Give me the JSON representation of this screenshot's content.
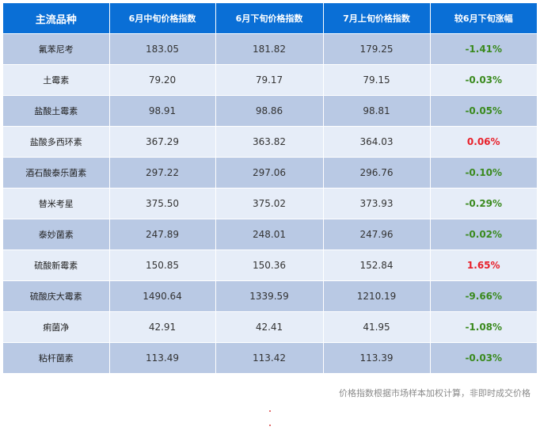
{
  "table": {
    "headers": [
      "主流品种",
      "6月中旬价格指数",
      "6月下旬价格指数",
      "7月上旬价格指数",
      "较6月下旬涨幅"
    ],
    "rows": [
      {
        "name": "氟苯尼考",
        "mid_june": "183.05",
        "late_june": "181.82",
        "early_july": "179.25",
        "change": "-1.41%",
        "direction": "down"
      },
      {
        "name": "土霉素",
        "mid_june": "79.20",
        "late_june": "79.17",
        "early_july": "79.15",
        "change": "-0.03%",
        "direction": "down"
      },
      {
        "name": "盐酸土霉素",
        "mid_june": "98.91",
        "late_june": "98.86",
        "early_july": "98.81",
        "change": "-0.05%",
        "direction": "down"
      },
      {
        "name": "盐酸多西环素",
        "mid_june": "367.29",
        "late_june": "363.82",
        "early_july": "364.03",
        "change": "0.06%",
        "direction": "up"
      },
      {
        "name": "酒石酸泰乐菌素",
        "mid_june": "297.22",
        "late_june": "297.06",
        "early_july": "296.76",
        "change": "-0.10%",
        "direction": "down"
      },
      {
        "name": "替米考星",
        "mid_june": "375.50",
        "late_june": "375.02",
        "early_july": "373.93",
        "change": "-0.29%",
        "direction": "down"
      },
      {
        "name": "泰妙菌素",
        "mid_june": "247.89",
        "late_june": "248.01",
        "early_july": "247.96",
        "change": "-0.02%",
        "direction": "down"
      },
      {
        "name": "硫酸新霉素",
        "mid_june": "150.85",
        "late_june": "150.36",
        "early_july": "152.84",
        "change": "1.65%",
        "direction": "up"
      },
      {
        "name": "硫酸庆大霉素",
        "mid_june": "1490.64",
        "late_june": "1339.59",
        "early_july": "1210.19",
        "change": "-9.66%",
        "direction": "down"
      },
      {
        "name": "痢菌净",
        "mid_june": "42.91",
        "late_june": "42.41",
        "early_july": "41.95",
        "change": "-1.08%",
        "direction": "down"
      },
      {
        "name": "粘杆菌素",
        "mid_june": "113.49",
        "late_june": "113.42",
        "early_july": "113.39",
        "change": "-0.03%",
        "direction": "down"
      }
    ]
  },
  "footnote": "价格指数根据市场样本加权计算，非即时成交价格",
  "colors": {
    "header_bg": "#0a6fd6",
    "row_odd": "#b9c9e4",
    "row_even": "#e6edf8",
    "up": "#e8202a",
    "down": "#3a8a1e"
  }
}
